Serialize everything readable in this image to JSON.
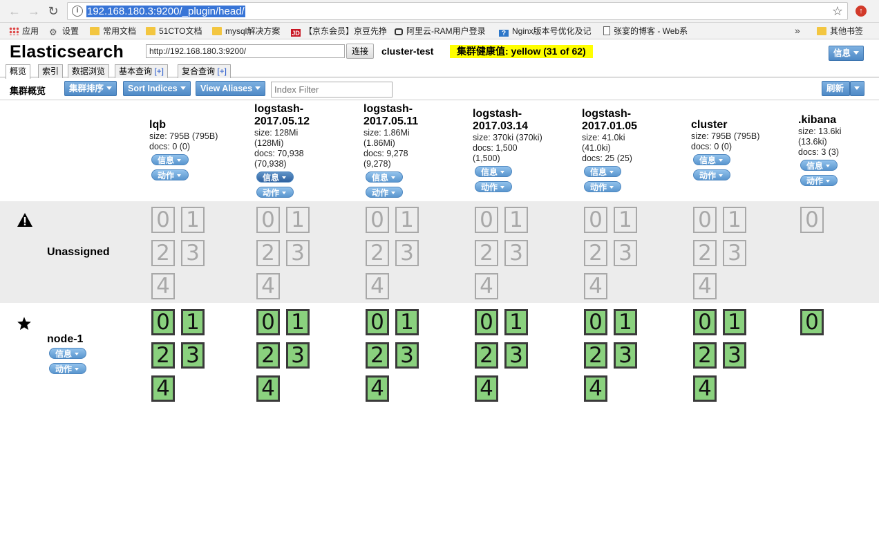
{
  "browser": {
    "url": "192.168.180.3:9200/_plugin/head/",
    "bookmarks": [
      {
        "label": "应用",
        "icon": "apps-icon"
      },
      {
        "label": "设置",
        "icon": "gear-icon"
      },
      {
        "label": "常用文档",
        "icon": "folder-icon"
      },
      {
        "label": "51CTO文档",
        "icon": "folder-icon"
      },
      {
        "label": "mysql解决方案",
        "icon": "folder-icon"
      },
      {
        "label": "【京东会员】京豆先挣",
        "icon": "jd-icon"
      },
      {
        "label": "阿里云-RAM用户登录",
        "icon": "aliyun-icon"
      },
      {
        "label": "Nginx版本号优化及记",
        "icon": "page-icon"
      },
      {
        "label": "张宴的博客 - Web系",
        "icon": "page-icon"
      },
      {
        "label": "其他书签",
        "icon": "folder-icon"
      }
    ],
    "more": "»"
  },
  "app": {
    "title": "Elasticsearch",
    "connect_url": "http://192.168.180.3:9200/",
    "connect_button": "连接",
    "cluster_name": "cluster-test",
    "health": "集群健康值: yellow (31 of 62)",
    "info_button": "信息"
  },
  "tabs": [
    {
      "label": "概览",
      "plus": ""
    },
    {
      "label": "索引",
      "plus": ""
    },
    {
      "label": "数据浏览",
      "plus": ""
    },
    {
      "label": "基本查询 ",
      "plus": "[+]"
    },
    {
      "label": "复合查询 ",
      "plus": "[+]"
    }
  ],
  "overview": {
    "label": "集群概览",
    "sort_cluster": "集群排序",
    "sort_indices": "Sort Indices",
    "view_aliases": "View Aliases",
    "index_filter_placeholder": "Index Filter",
    "refresh": "刷新"
  },
  "pill_labels": {
    "info": "信息",
    "action": "动作"
  },
  "indices": [
    {
      "name": "lqb",
      "size": "size: 795B (795B)",
      "docs": "docs: 0 (0)"
    },
    {
      "name": "logstash-\n2017.05.12",
      "size": "size: 128Mi\n(128Mi)",
      "docs": "docs: 70,938\n(70,938)"
    },
    {
      "name": "logstash-\n2017.05.11",
      "size": "size: 1.86Mi\n(1.86Mi)",
      "docs": "docs: 9,278\n(9,278)"
    },
    {
      "name": "logstash-\n2017.03.14",
      "size": "size: 370ki (370ki)",
      "docs": "docs: 1,500\n(1,500)"
    },
    {
      "name": "logstash-\n2017.01.05",
      "size": "size: 41.0ki\n(41.0ki)",
      "docs": "docs: 25 (25)"
    },
    {
      "name": "cluster",
      "size": "size: 795B (795B)",
      "docs": "docs: 0 (0)"
    },
    {
      "name": ".kibana",
      "size": "size: 13.6ki\n(13.6ki)",
      "docs": "docs: 3 (3)"
    }
  ],
  "rows": {
    "unassigned": {
      "label": "Unassigned",
      "icon": "warning-icon"
    },
    "node": {
      "label": "node-1",
      "icon": "star-icon"
    }
  },
  "shard_counts": [
    5,
    5,
    5,
    5,
    5,
    5,
    1
  ]
}
